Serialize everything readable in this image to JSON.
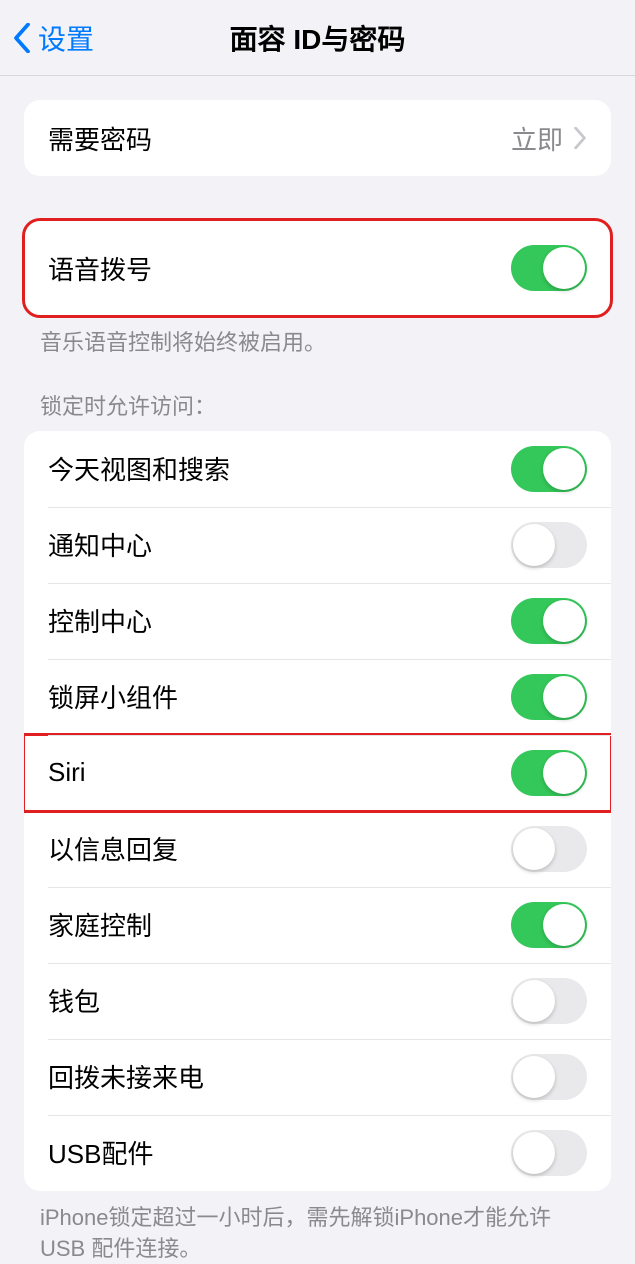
{
  "nav": {
    "back_label": "设置",
    "title": "面容 ID与密码"
  },
  "require_passcode": {
    "label": "需要密码",
    "value": "立即"
  },
  "voice_dial": {
    "label": "语音拨号",
    "footer": "音乐语音控制将始终被启用。"
  },
  "locked_access": {
    "header": "锁定时允许访问：",
    "items": [
      {
        "label": "今天视图和搜索",
        "on": true
      },
      {
        "label": "通知中心",
        "on": false
      },
      {
        "label": "控制中心",
        "on": true
      },
      {
        "label": "锁屏小组件",
        "on": true
      },
      {
        "label": "Siri",
        "on": true
      },
      {
        "label": "以信息回复",
        "on": false
      },
      {
        "label": "家庭控制",
        "on": true
      },
      {
        "label": "钱包",
        "on": false
      },
      {
        "label": "回拨未接来电",
        "on": false
      },
      {
        "label": "USB配件",
        "on": false
      }
    ],
    "footer": "iPhone锁定超过一小时后，需先解锁iPhone才能允许 USB 配件连接。"
  }
}
